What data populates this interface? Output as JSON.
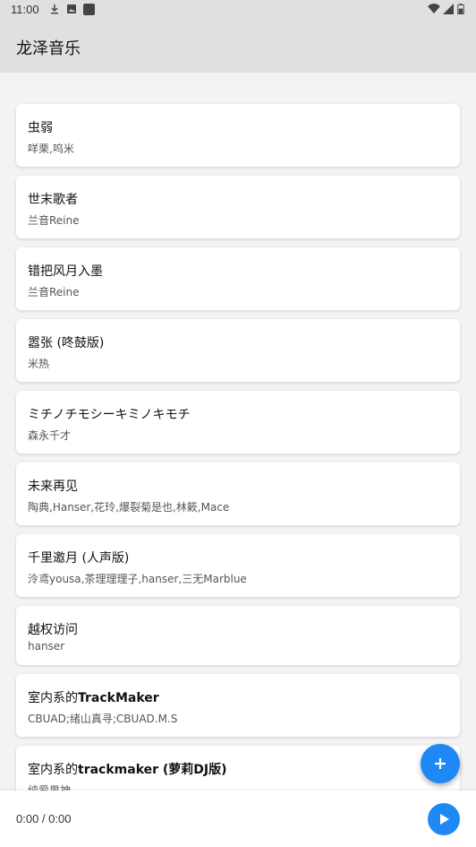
{
  "status_bar": {
    "time": "11:00",
    "left_icons": [
      "download-icon",
      "photo-icon",
      "app-square-icon"
    ],
    "right_icons": [
      "wifi-icon",
      "cell-signal-icon",
      "battery-icon"
    ]
  },
  "app_bar": {
    "title": "龙泽音乐"
  },
  "songs": [
    {
      "title": "虫弱",
      "artist": "咩栗,呜米"
    },
    {
      "title": "世末歌者",
      "artist": "兰音Reine"
    },
    {
      "title": "错把风月入墨",
      "artist": "兰音Reine"
    },
    {
      "title": "嚣张 (咚鼓版)",
      "artist": "米热"
    },
    {
      "title": "ミチノチモシーキミノキモチ",
      "artist": "森永千才"
    },
    {
      "title": "未来再见",
      "artist": "陶典,Hanser,花玲,爆裂菊是也,林簌,Mace"
    },
    {
      "title": "千里邀月 (人声版)",
      "artist": "泠鸢yousa,茶理理理子,hanser,三无Marblue"
    },
    {
      "title": "越权访问",
      "artist": "hanser"
    },
    {
      "title_prefix": "室内系的",
      "title_bold": "TrackMaker",
      "artist": "CBUAD;绪山真寻;CBUAD.M.S"
    },
    {
      "title_prefix": "室内系的",
      "title_bold": "trackmaker (萝莉DJ版)",
      "artist": "纯爱男神"
    }
  ],
  "fab": {
    "icon": "plus-icon"
  },
  "player": {
    "time": "0:00 / 0:00",
    "play_icon": "play-icon"
  },
  "colors": {
    "accent": "#1e88f5",
    "bar_bg": "#e0e0e0",
    "page_bg": "#f3f3f3"
  }
}
